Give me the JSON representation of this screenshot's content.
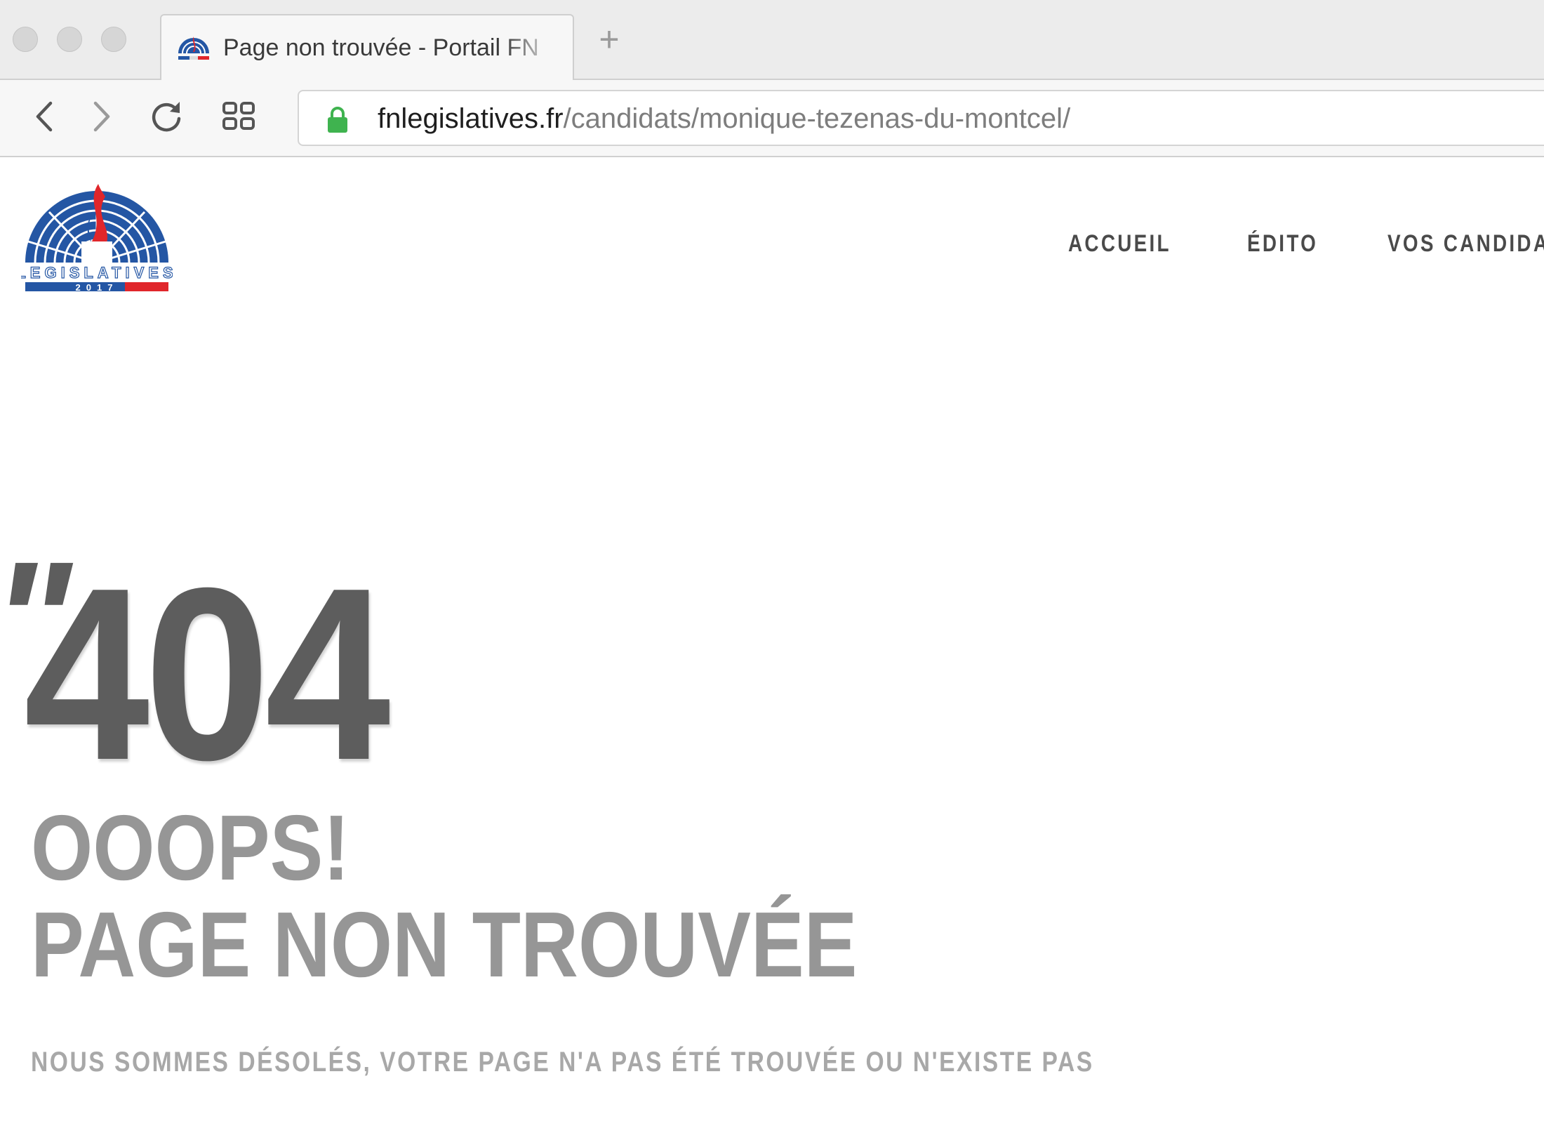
{
  "browser": {
    "tab": {
      "title": "Page non trouvée - Portail FN",
      "favicon": "legislatives-favicon-icon"
    },
    "new_tab_label": "+",
    "nav_icons": [
      "back-icon",
      "forward-icon",
      "reload-icon",
      "grid-icon"
    ],
    "url": {
      "host": "fnlegislatives.fr",
      "path": "/candidats/monique-tezenas-du-montcel/",
      "secure_icon": "lock-icon"
    }
  },
  "site": {
    "logo": {
      "text": "LEGISLATIVES",
      "year": "2017"
    },
    "nav": {
      "items": [
        {
          "label": "ACCUEIL"
        },
        {
          "label": "ÉDITO"
        },
        {
          "label": "VOS CANDIDATS"
        }
      ]
    }
  },
  "error": {
    "quote": "\"",
    "code": "404",
    "ooops": "OOOPS!",
    "title": "PAGE NON TROUVÉE",
    "message": "NOUS SOMMES DÉSOLÉS, VOTRE PAGE N'A PAS ÉTÉ TROUVÉE OU N'EXISTE PAS"
  },
  "colors": {
    "logo_blue": "#2456a4",
    "logo_red": "#e0262b",
    "secure_green": "#3fb34f",
    "heading_dark": "#5d5d5d",
    "heading_light": "#969696"
  }
}
